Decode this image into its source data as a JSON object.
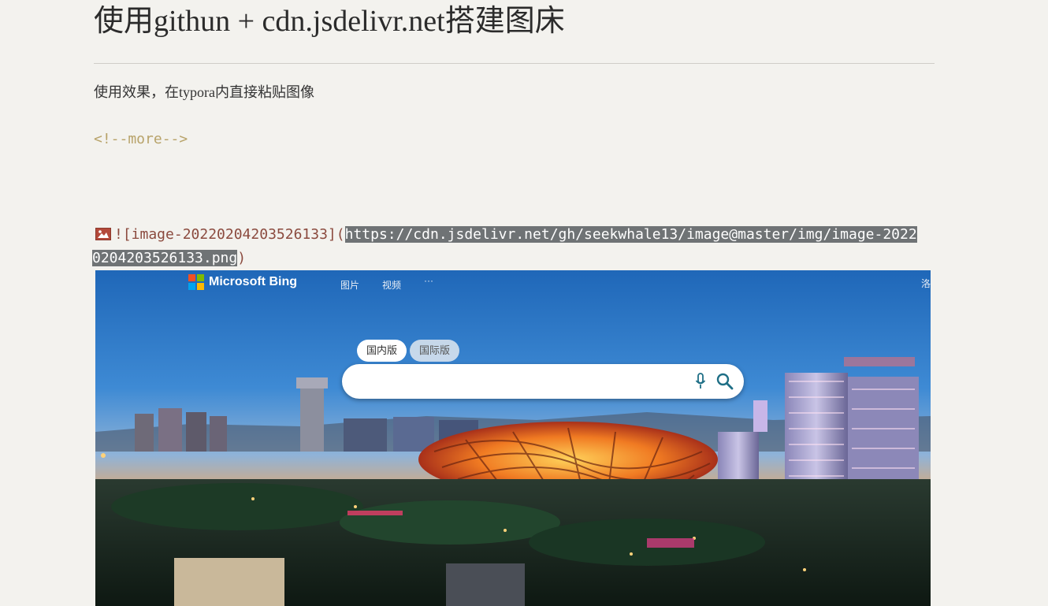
{
  "document": {
    "title": "使用githun + cdn.jsdelivr.net搭建图床",
    "paragraph": "使用效果，在typora内直接粘贴图像",
    "more_comment": "<!--more-->",
    "image_markdown": {
      "prefix": "![image-20220204203526133](",
      "url_part1": "https://cdn.jsdelivr.net/gh/seekwhale13/image@master/img/image-2022",
      "url_part2": "0204203526133.png",
      "suffix": ")"
    }
  },
  "preview": {
    "logo_text": "Microsoft Bing",
    "nav_images": "图片",
    "nav_videos": "视频",
    "nav_more": "···",
    "edge_text": "洛",
    "tab_domestic": "国内版",
    "tab_international": "国际版",
    "search_value": ""
  },
  "colors": {
    "background": "#f3f2ee",
    "comment": "#b8a36a",
    "markdown": "#8b4a3e",
    "selection": "#6f7375"
  }
}
